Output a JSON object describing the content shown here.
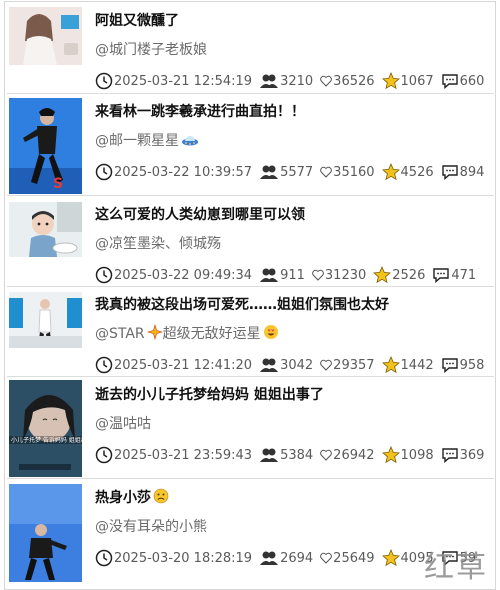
{
  "posts": [
    {
      "title": "阿姐又微醺了",
      "author": "@城门楼子老板娘",
      "time": "2025-03-21 12:54:19",
      "views": "3210",
      "likes": "36526",
      "favorites": "1067",
      "comments": "660"
    },
    {
      "title": "来看林一跳李羲承进行曲直拍！！",
      "author": "@邮一颗星星",
      "time": "2025-03-22 10:39:57",
      "views": "5577",
      "likes": "35160",
      "favorites": "4526",
      "comments": "894"
    },
    {
      "title": "这么可爱的人类幼崽到哪里可以领",
      "author": "@凉笙墨染、倾城殇",
      "time": "2025-03-22 09:49:34",
      "views": "911",
      "likes": "31230",
      "favorites": "2526",
      "comments": "471"
    },
    {
      "title": "我真的被这段出场可爱死……姐姐们氛围也太好",
      "author": "@STAR",
      "author_suffix": "超级无敌好运星",
      "time": "2025-03-21 12:41:20",
      "views": "3042",
      "likes": "29357",
      "favorites": "1442",
      "comments": "958"
    },
    {
      "title": "逝去的小儿子托梦给妈妈 姐姐出事了",
      "author": "@温咕咕",
      "time": "2025-03-21 23:59:43",
      "views": "5384",
      "likes": "26942",
      "favorites": "1098",
      "comments": "369",
      "thumb_caption": "小儿子托梦 告诉妈妈 姐姐出事"
    },
    {
      "title": "热身小莎",
      "author": "@没有耳朵的小熊",
      "time": "2025-03-20 18:28:19",
      "views": "2694",
      "likes": "25649",
      "favorites": "4095",
      "comments": "59"
    }
  ],
  "watermark": "红草",
  "colors": {
    "star": "#f2c21b",
    "text": "#111111",
    "muted": "#6b6b6b"
  }
}
